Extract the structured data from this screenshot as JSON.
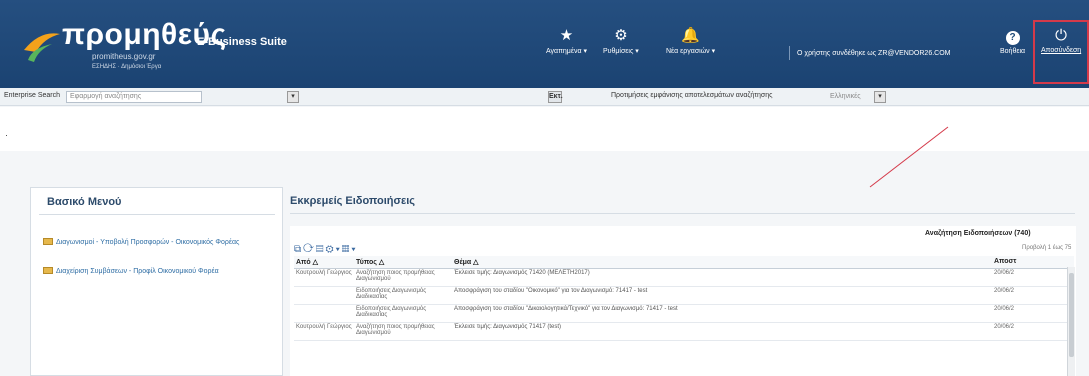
{
  "header": {
    "logo_title": "προμηθεύς",
    "suite": "E-Business Suite",
    "url": "promitheus.gov.gr",
    "tagline": "ΕΣΗΔΗΣ · Δημόσιοι Έργα",
    "nav": [
      {
        "label": "Αγαπημένα",
        "icon": "star-icon"
      },
      {
        "label": "Ρυθμίσεις",
        "icon": "gear-icon"
      },
      {
        "label": "Νέα εργασιών",
        "icon": "bell-icon"
      }
    ],
    "user_text": "Ο χρήστης συνδέθηκε ως ZR@VENDOR26.COM",
    "help_label": "Βοήθεια",
    "logout_label": "Αποσύνδεση"
  },
  "search": {
    "label": "Enterprise Search",
    "placeholder": "Εφαρμογή αναζήτησης",
    "go_label": "Εκτ.",
    "pref_label": "Προτιμήσεις εμφάνισης αποτελεσμάτων αναζήτησης",
    "pref_value": "Ελληνικές"
  },
  "menu": {
    "title": "Βασικό Μενού",
    "items": [
      "Διαγωνισμοί - Υποβολή Προσφορών - Οικονομικός Φορέας",
      "Διαχείριση Συμβάσεων - Προφίλ Οικονομικού Φορέα"
    ]
  },
  "notifications": {
    "title": "Εκκρεμείς Ειδοποιήσεις",
    "search_button": "Αναζήτηση Ειδοποιήσεων (740)",
    "count": "Προβολή 1 έως 75",
    "columns": [
      "Από",
      "Τύπος",
      "Θέμα",
      "Αποστ"
    ],
    "rows": [
      {
        "from": "Κουτρουλή Γεώργιος",
        "type": "Αναζήτηση ποιος προμήθειας Διαγωνισμού",
        "subject": "Έκλεισε τιμής: Διαγωνισμός 71420 (ΜΕΛΕΤΗ2017)",
        "date": "20/06/2"
      },
      {
        "from": "",
        "type": "Ειδοποιήσεις Διαγωνισμός Διαδικασίας",
        "subject": "Αποσφράγιση του σταδίου \"Οικονομικό\" για τον Διαγωνισμό: 71417 - test",
        "date": "20/06/2"
      },
      {
        "from": "",
        "type": "Ειδοποιήσεις Διαγωνισμός Διαδικασίας",
        "subject": "Αποσφράγιση του σταδίου \"Δικαιολογητικά/Τεχνικό\" για τον Διαγωνισμό: 71417 - test",
        "date": "20/06/2"
      },
      {
        "from": "Κουτρουλή Γεώργιος",
        "type": "Αναζήτηση ποιος προμήθειας Διαγωνισμού",
        "subject": "Έκλεισε τιμής: Διαγωνισμός 71417 (test)",
        "date": "20/06/2"
      }
    ]
  }
}
